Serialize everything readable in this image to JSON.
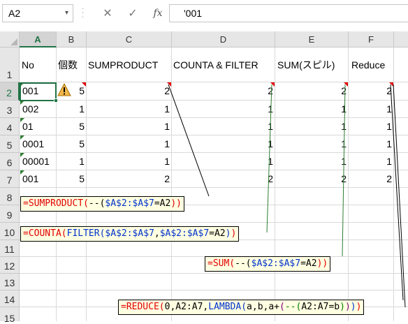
{
  "formula_bar": {
    "name_box": "A2",
    "name_box_arrow": "▾",
    "cancel_icon": "✕",
    "enter_icon": "✓",
    "fx_label": "fx",
    "formula_value": "'001"
  },
  "columns": [
    "A",
    "B",
    "C",
    "D",
    "E",
    "F"
  ],
  "selected_column": "A",
  "rows": [
    "1",
    "2",
    "3",
    "4",
    "5",
    "6",
    "7",
    "8",
    "9",
    "10",
    "11",
    "12",
    "13",
    "14",
    "15"
  ],
  "selected_row": "2",
  "headers": {
    "a": "No",
    "b": "個数",
    "c": "SUMPRODUCT",
    "d": "COUNTA & FILTER",
    "e": "SUM(スピル)",
    "f": "Reduce"
  },
  "data_rows": [
    {
      "no": "001",
      "count": "5",
      "sumproduct": "2",
      "counta_filter": "2",
      "sum_spill": "2",
      "reduce": "2"
    },
    {
      "no": "002",
      "count": "1",
      "sumproduct": "1",
      "counta_filter": "1",
      "sum_spill": "1",
      "reduce": "1"
    },
    {
      "no": "01",
      "count": "5",
      "sumproduct": "1",
      "counta_filter": "1",
      "sum_spill": "1",
      "reduce": "1"
    },
    {
      "no": "0001",
      "count": "5",
      "sumproduct": "1",
      "counta_filter": "1",
      "sum_spill": "1",
      "reduce": "1"
    },
    {
      "no": "00001",
      "count": "1",
      "sumproduct": "1",
      "counta_filter": "1",
      "sum_spill": "1",
      "reduce": "1"
    },
    {
      "no": "001",
      "count": "5",
      "sumproduct": "2",
      "counta_filter": "2",
      "sum_spill": "2",
      "reduce": "2"
    }
  ],
  "comments": {
    "sumproduct": [
      {
        "t": "=SUMPRODUCT(",
        "c": "red"
      },
      {
        "t": "--(",
        "c": "black"
      },
      {
        "t": "$A$2:$A$7",
        "c": "blue"
      },
      {
        "t": "=A2",
        "c": "black"
      },
      {
        "t": "))",
        "c": "red"
      }
    ],
    "counta_filter": [
      {
        "t": "=COUNTA(",
        "c": "red"
      },
      {
        "t": "FILTER(",
        "c": "blue"
      },
      {
        "t": "$A$2:$A$7",
        "c": "blue"
      },
      {
        "t": ",",
        "c": "black"
      },
      {
        "t": "$A$2:$A$7",
        "c": "blue"
      },
      {
        "t": "=A2",
        "c": "black"
      },
      {
        "t": ")",
        "c": "blue"
      },
      {
        "t": ")",
        "c": "red"
      }
    ],
    "sum_spill": [
      {
        "t": "=SUM(",
        "c": "red"
      },
      {
        "t": "--(",
        "c": "black"
      },
      {
        "t": "$A$2:$A$7",
        "c": "blue"
      },
      {
        "t": "=A2",
        "c": "black"
      },
      {
        "t": "))",
        "c": "red"
      }
    ],
    "reduce": [
      {
        "t": "=REDUCE(",
        "c": "red"
      },
      {
        "t": "0,A2:A7,",
        "c": "black"
      },
      {
        "t": "LAMBDA(",
        "c": "blue"
      },
      {
        "t": "a,b,a+",
        "c": "black"
      },
      {
        "t": "(",
        "c": "purple"
      },
      {
        "t": "--(",
        "c": "green"
      },
      {
        "t": "A2:A7=b",
        "c": "black"
      },
      {
        "t": ")",
        "c": "green"
      },
      {
        "t": ")",
        "c": "purple"
      },
      {
        "t": ")",
        "c": "blue"
      },
      {
        "t": ")",
        "c": "red"
      }
    ]
  },
  "colors": {
    "accent": "#217346",
    "comment_bg": "#ffffe1",
    "red": "#e00000",
    "blue": "#0033cc",
    "green": "#008000",
    "purple": "#800080",
    "black": "#000000"
  },
  "icons": {
    "warning": "warning-triangle-icon",
    "error_indicator": "green-corner-triangle",
    "comment_indicator": "red-corner-triangle"
  }
}
